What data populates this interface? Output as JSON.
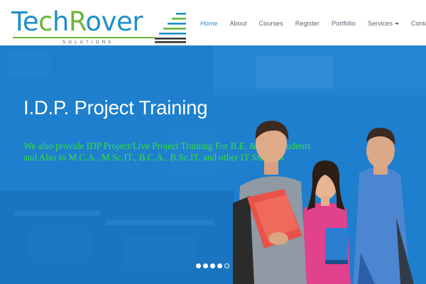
{
  "logo": {
    "parts": [
      "Te",
      "c",
      "h",
      "R",
      "over"
    ],
    "tagline": "SOLUTIONS"
  },
  "nav": {
    "items": [
      {
        "label": "Home",
        "active": true
      },
      {
        "label": "About"
      },
      {
        "label": "Courses"
      },
      {
        "label": "Register"
      },
      {
        "label": "Portfolio"
      },
      {
        "label": "Services",
        "dropdown": true
      },
      {
        "label": "Contact"
      }
    ]
  },
  "hero": {
    "title": "I.D.P. Project Training",
    "description": "We also provide IDP Project/Live Project Training For B.E. & D.E. Students and Also to M.C.A., M.Sc.IT., B.C.A., B.Sc.IT. and other IT Students",
    "slides_total": 5,
    "active_slide": 4
  },
  "colors": {
    "brand_blue": "#1e8fc9",
    "brand_green": "#6cb539",
    "nav_active": "#2b8fd6",
    "hero_bg": "#1d80cf",
    "hero_desc_text": "#36e041"
  },
  "icons": {
    "logo_mark": "stacked-lines-logo-icon",
    "services_caret": "caret-down-icon"
  }
}
